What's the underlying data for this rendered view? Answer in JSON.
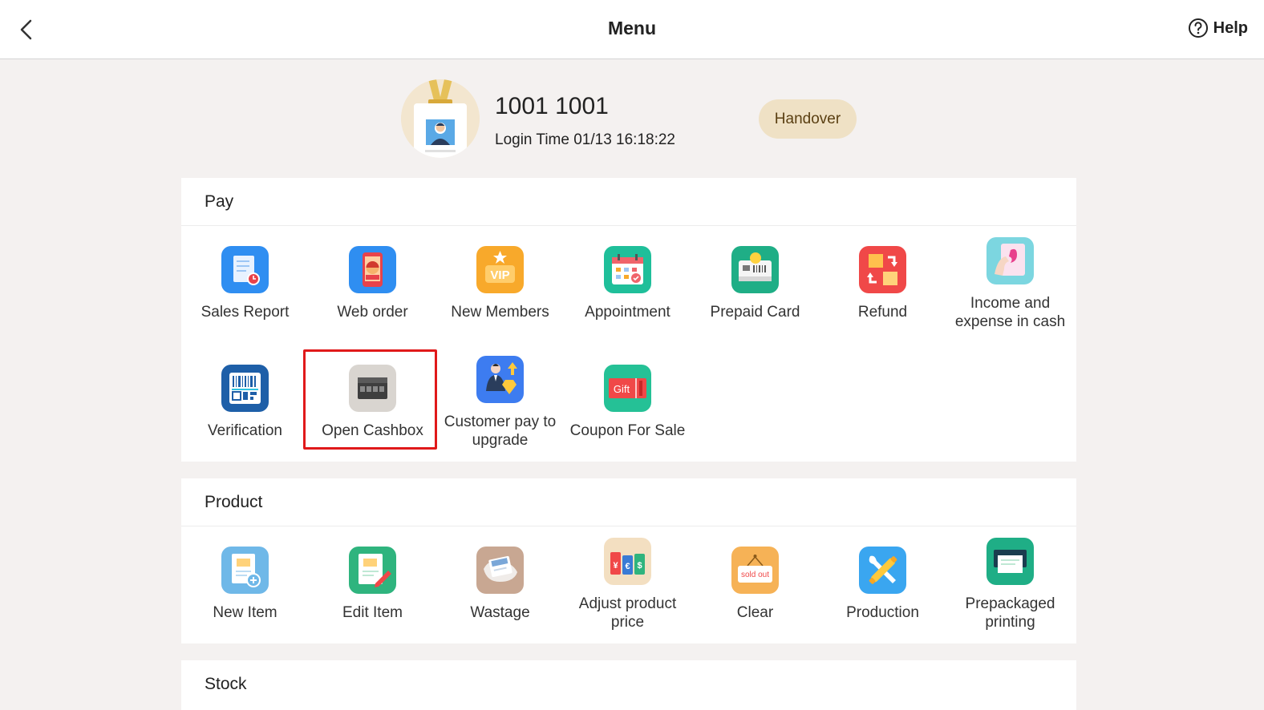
{
  "header": {
    "title": "Menu",
    "help_label": "Help"
  },
  "user": {
    "name": "1001 1001",
    "login_time": "Login Time 01/13 16:18:22",
    "handover_label": "Handover"
  },
  "sections": {
    "pay": {
      "title": "Pay",
      "items": [
        {
          "label": "Sales Report",
          "icon": "sales-report-icon"
        },
        {
          "label": "Web order",
          "icon": "web-order-icon"
        },
        {
          "label": "New Members",
          "icon": "vip-icon"
        },
        {
          "label": "Appointment",
          "icon": "calendar-icon"
        },
        {
          "label": "Prepaid Card",
          "icon": "prepaid-card-icon"
        },
        {
          "label": "Refund",
          "icon": "refund-icon"
        },
        {
          "label": "Income and expense in cash",
          "icon": "cash-hand-icon"
        },
        {
          "label": "Verification",
          "icon": "barcode-icon"
        },
        {
          "label": "Open Cashbox",
          "icon": "cashbox-icon"
        },
        {
          "label": "Customer pay to upgrade",
          "icon": "upgrade-icon"
        },
        {
          "label": "Coupon For Sale",
          "icon": "gift-coupon-icon",
          "icon_text": "Gift"
        }
      ]
    },
    "product": {
      "title": "Product",
      "items": [
        {
          "label": "New Item",
          "icon": "new-item-icon"
        },
        {
          "label": "Edit Item",
          "icon": "edit-item-icon"
        },
        {
          "label": "Wastage",
          "icon": "wastage-icon"
        },
        {
          "label": "Adjust product price",
          "icon": "price-tags-icon"
        },
        {
          "label": "Clear",
          "icon": "sold-out-icon",
          "icon_text": "sold out"
        },
        {
          "label": "Production",
          "icon": "production-icon"
        },
        {
          "label": "Prepackaged printing",
          "icon": "printer-icon"
        }
      ]
    },
    "stock": {
      "title": "Stock"
    }
  },
  "colors": {
    "background": "#f4f1f0",
    "highlight": "#e0191a",
    "handover_bg": "#efe1c5"
  }
}
